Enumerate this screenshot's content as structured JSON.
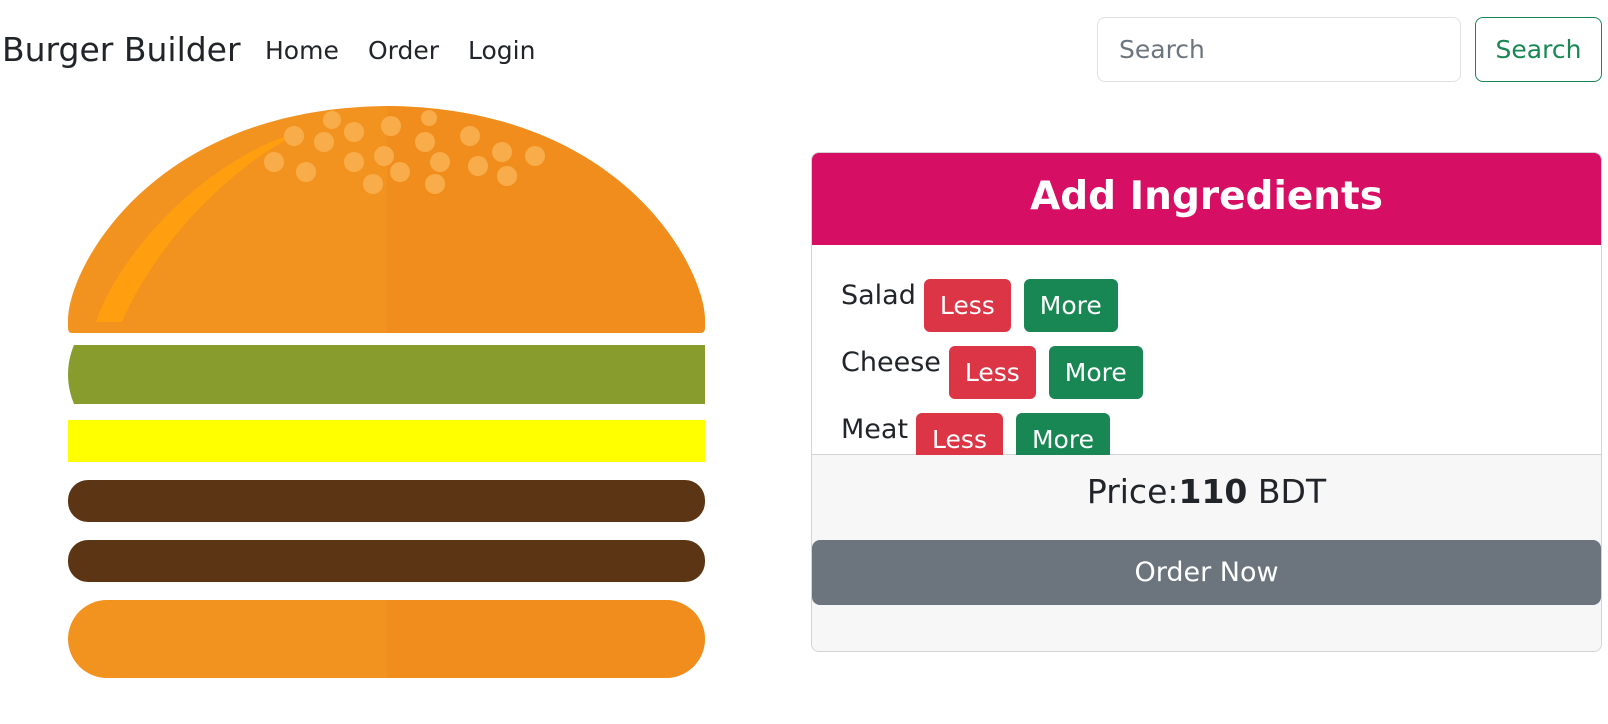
{
  "navbar": {
    "brand": "Burger Builder",
    "links": [
      "Home",
      "Order",
      "Login"
    ],
    "search": {
      "placeholder": "Search",
      "value": "",
      "button_label": "Search"
    }
  },
  "burger": {
    "layers": [
      "bread-top",
      "salad",
      "cheese",
      "meat",
      "meat",
      "bread-bottom"
    ],
    "colors": {
      "bread": "#f2921f",
      "bread_highlight": "#ff9e0f",
      "seeds": "#f9ad4a",
      "salad": "#879c2d",
      "cheese": "#ffff00",
      "meat": "#5c3614"
    }
  },
  "controls": {
    "title": "Add Ingredients",
    "ingredients": [
      {
        "label": "Salad",
        "less": "Less",
        "more": "More"
      },
      {
        "label": "Cheese",
        "less": "Less",
        "more": "More"
      },
      {
        "label": "Meat",
        "less": "Less",
        "more": "More"
      }
    ],
    "price": {
      "prefix": "Price:",
      "amount": "110",
      "currency": "BDT"
    },
    "order_button": "Order Now"
  },
  "colors": {
    "header": "#d70f64",
    "less": "#dc3545",
    "more": "#198754",
    "order": "#6c757d",
    "search_outline": "#198754"
  }
}
